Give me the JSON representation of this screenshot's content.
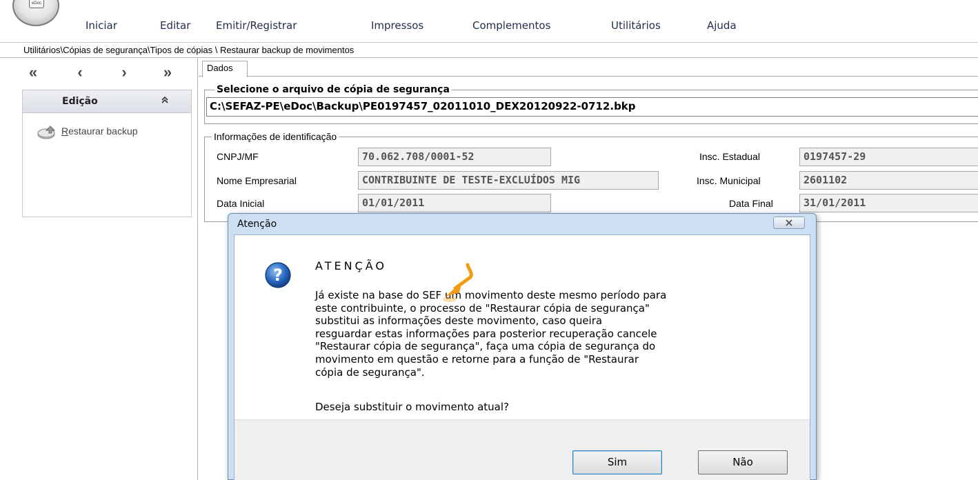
{
  "app": {
    "logo_text": "eDoc"
  },
  "menu": {
    "items": [
      "Iniciar",
      "Editar",
      "Emitir/Registrar",
      "Impressos",
      "Complementos",
      "Utilitários",
      "Ajuda"
    ]
  },
  "breadcrumb": "Utilitários\\Cópias de segurança\\Tipos de cópias \\ Restaurar backup de movimentos",
  "left_panel": {
    "nav": [
      "«",
      "‹",
      "›",
      "»"
    ],
    "group_title": "Edição",
    "collapse_icon": "chevron-up-icon",
    "actions": [
      {
        "label": "Restaurar backup",
        "icon": "restore-backup-icon"
      }
    ]
  },
  "main": {
    "tab": "Dados",
    "file_section": {
      "legend": "Selecione o arquivo de cópia de segurança",
      "path": "C:\\SEFAZ-PE\\eDoc\\Backup\\PE0197457_02011010_DEX20120922-0712.bkp"
    },
    "info_section": {
      "legend": "Informações de identificação",
      "cnpj_label": "CNPJ/MF",
      "cnpj_value": "70.062.708/0001-52",
      "nome_label": "Nome Empresarial",
      "nome_value": "CONTRIBUINTE DE TESTE-EXCLUÍDOS MIG",
      "data_inicial_label": "Data Inicial",
      "data_inicial_value": "01/01/2011",
      "insc_estadual_label": "Insc. Estadual",
      "insc_estadual_value": "0197457-29",
      "insc_municipal_label": "Insc. Municipal",
      "insc_municipal_value": "2601102",
      "data_final_label": "Data Final",
      "data_final_value": "31/01/2011"
    }
  },
  "dialog": {
    "title": "Atenção",
    "close_icon": "close-icon",
    "icon": "question-icon",
    "heading": "ATENÇÃO",
    "message": "Já existe na base do SEF um movimento  deste mesmo período para\neste contribuinte, o processo de \"Restaurar cópia de segurança\"\nsubstitui  as  informações  deste  movimento,  caso  queira\nresguardar estas informações para posterior recuperação cancele\n\"Restaurar cópia de segurança\", faça  uma cópia de segurança do\nmovimento  em  questão  e  retorne  para a função de \"Restaurar\ncópia de segurança\".",
    "question": "Deseja substituir o movimento atual?",
    "yes_label": "Sim",
    "no_label": "Não"
  },
  "colors": {
    "dialog_frame": "#cde0f3",
    "menu_text": "#1d2d4b",
    "annotation_arrow": "#f39c12"
  }
}
